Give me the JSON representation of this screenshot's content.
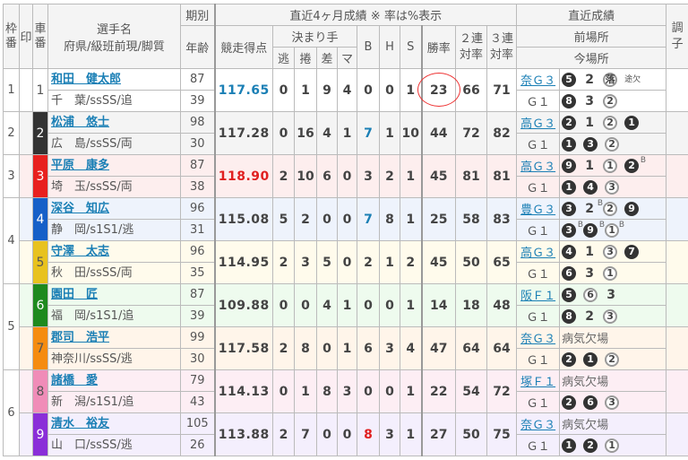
{
  "header": {
    "waku": "枠番",
    "mark": "印",
    "car": "車番",
    "name": "選手名",
    "name_sub": "府県/級班前現/脚質",
    "term": "期別",
    "age": "年齢",
    "recent4": "直近4ヶ月成績 ※ 率は%表示",
    "score": "競走得点",
    "kimarite": "決まり手",
    "nige": "逃",
    "makuri": "捲",
    "sashi": "差",
    "mark_k": "マ",
    "b": "B",
    "h": "H",
    "s": "S",
    "win": "勝率",
    "ren2": "２連対率",
    "ren3": "３連対率",
    "recent": "直近成績",
    "prev": "前場所",
    "curr": "今場所",
    "cond": "調子"
  },
  "colors": {
    "link": "#1a7fb5",
    "score_high": "#e02020",
    "b_blue": "#1a7fb5",
    "b_red": "#e02020"
  },
  "rows": [
    {
      "waku": "1",
      "car": "1",
      "car_color": "#ffffff",
      "car_text": "#555",
      "bg": "#ffffff",
      "name": "和田　健太郎",
      "info": "千　葉/ssSS/追",
      "term": "87",
      "age": "39",
      "score": "117.65",
      "score_color": "#1a7fb5",
      "k": [
        "0",
        "1",
        "9",
        "4"
      ],
      "b": "0",
      "h": "0",
      "s": "1",
      "win": "23",
      "r2": "66",
      "r3": "71",
      "prev_place": "奈Ｇ３",
      "prev": [
        {
          "n": "5",
          "t": "black"
        },
        {
          "n": "2",
          "t": "plain"
        },
        {
          "n": "落",
          "t": "white"
        },
        {
          "n": "途欠",
          "t": "word"
        }
      ],
      "curr_place": "Ｇ１",
      "curr": [
        {
          "n": "8",
          "t": "black"
        },
        {
          "n": "3",
          "t": "plain"
        },
        {
          "n": "2",
          "t": "white"
        }
      ]
    },
    {
      "waku": "2",
      "car": "2",
      "car_color": "#333333",
      "car_text": "#fff",
      "bg": "#f4f4f4",
      "name": "松浦　悠士",
      "info": "広　島/ssSS/両",
      "term": "98",
      "age": "30",
      "score": "117.28",
      "k": [
        "0",
        "16",
        "4",
        "1"
      ],
      "b": "7",
      "b_color": "#1a7fb5",
      "h": "1",
      "s": "10",
      "win": "44",
      "r2": "72",
      "r3": "82",
      "prev_place": "高Ｇ３",
      "prev": [
        {
          "n": "2",
          "t": "black"
        },
        {
          "n": "1",
          "t": "plain"
        },
        {
          "n": "2",
          "t": "white"
        },
        {
          "n": "1",
          "t": "black"
        }
      ],
      "curr_place": "Ｇ１",
      "curr": [
        {
          "n": "1",
          "t": "black"
        },
        {
          "n": "3",
          "t": "black"
        },
        {
          "n": "2",
          "t": "white"
        }
      ]
    },
    {
      "waku": "3",
      "car": "3",
      "car_color": "#e8201e",
      "car_text": "#fff",
      "bg": "#fdeeee",
      "name": "平原　康多",
      "info": "埼　玉/ssSS/両",
      "term": "87",
      "age": "38",
      "score": "118.90",
      "score_color": "#e02020",
      "k": [
        "2",
        "10",
        "6",
        "0"
      ],
      "b": "3",
      "h": "2",
      "s": "1",
      "win": "45",
      "r2": "81",
      "r3": "81",
      "prev_place": "高Ｇ３",
      "prev": [
        {
          "n": "9",
          "t": "black"
        },
        {
          "n": "1",
          "t": "plain"
        },
        {
          "n": "1",
          "t": "white"
        },
        {
          "n": "2",
          "t": "black",
          "sup": "B"
        }
      ],
      "curr_place": "Ｇ１",
      "curr": [
        {
          "n": "1",
          "t": "black"
        },
        {
          "n": "4",
          "t": "black"
        },
        {
          "n": "3",
          "t": "white"
        }
      ]
    },
    {
      "waku": "4",
      "car": "4",
      "car_color": "#1560c8",
      "car_text": "#fff",
      "bg": "#eef3fc",
      "name": "深谷　知広",
      "info": "静　岡/s1S1/逃",
      "term": "96",
      "age": "31",
      "score": "115.08",
      "k": [
        "5",
        "2",
        "0",
        "0"
      ],
      "b": "7",
      "b_color": "#1a7fb5",
      "h": "8",
      "s": "1",
      "win": "25",
      "r2": "58",
      "r3": "83",
      "prev_place": "豊Ｇ３",
      "prev": [
        {
          "n": "3",
          "t": "black"
        },
        {
          "n": "2",
          "t": "plain",
          "sup": "B"
        },
        {
          "n": "2",
          "t": "white"
        },
        {
          "n": "9",
          "t": "black"
        }
      ],
      "curr_place": "Ｇ１",
      "curr": [
        {
          "n": "3",
          "t": "black",
          "sup": "B"
        },
        {
          "n": "9",
          "t": "black",
          "sup": "B"
        },
        {
          "n": "1",
          "t": "white",
          "sup": "B"
        }
      ]
    },
    {
      "waku": "4",
      "car": "5",
      "car_color": "#e8c21e",
      "car_text": "#555",
      "bg": "#fffbec",
      "name": "守澤　太志",
      "info": "秋　田/ssSS/両",
      "term": "96",
      "age": "35",
      "score": "114.95",
      "k": [
        "2",
        "3",
        "5",
        "0"
      ],
      "b": "2",
      "h": "1",
      "s": "2",
      "win": "45",
      "r2": "50",
      "r3": "65",
      "prev_place": "高Ｇ３",
      "prev": [
        {
          "n": "4",
          "t": "black"
        },
        {
          "n": "1",
          "t": "plain"
        },
        {
          "n": "3",
          "t": "white"
        },
        {
          "n": "7",
          "t": "black"
        }
      ],
      "curr_place": "Ｇ１",
      "curr": [
        {
          "n": "6",
          "t": "black"
        },
        {
          "n": "3",
          "t": "plain"
        },
        {
          "n": "1",
          "t": "white"
        }
      ]
    },
    {
      "waku": "5",
      "car": "6",
      "car_color": "#1e8a1e",
      "car_text": "#fff",
      "bg": "#eefbee",
      "name": "園田　匠",
      "info": "福　岡/s1S1/追",
      "term": "87",
      "age": "39",
      "score": "109.88",
      "k": [
        "0",
        "0",
        "4",
        "1"
      ],
      "b": "0",
      "h": "0",
      "s": "1",
      "win": "14",
      "r2": "18",
      "r3": "48",
      "prev_place": "阪Ｆ１",
      "prev": [
        {
          "n": "5",
          "t": "black"
        },
        {
          "n": "6",
          "t": "white"
        },
        {
          "n": "3",
          "t": "plain"
        }
      ],
      "curr_place": "Ｇ１",
      "curr": [
        {
          "n": "8",
          "t": "black"
        },
        {
          "n": "2",
          "t": "plain"
        },
        {
          "n": "3",
          "t": "white"
        }
      ]
    },
    {
      "waku": "5",
      "car": "7",
      "car_color": "#f58c10",
      "car_text": "#555",
      "bg": "#fff5ea",
      "name": "郡司　浩平",
      "info": "神奈川/ssSS/逃",
      "term": "99",
      "age": "30",
      "score": "117.58",
      "k": [
        "2",
        "8",
        "0",
        "1"
      ],
      "b": "6",
      "h": "3",
      "s": "4",
      "win": "47",
      "r2": "64",
      "r3": "64",
      "prev_place": "奈Ｇ３",
      "prev_text": "病気欠場",
      "prev": [],
      "curr_place": "Ｇ１",
      "curr": [
        {
          "n": "2",
          "t": "black"
        },
        {
          "n": "1",
          "t": "black"
        },
        {
          "n": "2",
          "t": "white"
        }
      ]
    },
    {
      "waku": "6",
      "car": "8",
      "car_color": "#f08cb8",
      "car_text": "#555",
      "bg": "#fdeef4",
      "name": "諸橋　愛",
      "info": "新　潟/s1S1/追",
      "term": "79",
      "age": "43",
      "score": "114.13",
      "k": [
        "0",
        "1",
        "8",
        "3"
      ],
      "b": "0",
      "h": "0",
      "s": "1",
      "win": "22",
      "r2": "54",
      "r3": "72",
      "prev_place": "塚Ｆ１",
      "prev_text": "病気欠場",
      "prev": [],
      "curr_place": "Ｇ１",
      "curr": [
        {
          "n": "2",
          "t": "black"
        },
        {
          "n": "6",
          "t": "black"
        },
        {
          "n": "3",
          "t": "white"
        }
      ]
    },
    {
      "waku": "6",
      "car": "9",
      "car_color": "#8a2ed8",
      "car_text": "#fff",
      "bg": "#f4effd",
      "name": "清水　裕友",
      "info": "山　口/ssSS/逃",
      "term": "105",
      "age": "26",
      "score": "113.88",
      "k": [
        "2",
        "7",
        "0",
        "0"
      ],
      "b": "8",
      "b_color": "#e02020",
      "h": "3",
      "s": "1",
      "win": "27",
      "r2": "50",
      "r3": "75",
      "prev_place": "奈Ｇ３",
      "prev_text": "病気欠場",
      "prev": [],
      "curr_place": "Ｇ１",
      "curr": [
        {
          "n": "1",
          "t": "black"
        },
        {
          "n": "2",
          "t": "black"
        },
        {
          "n": "1",
          "t": "white"
        }
      ]
    }
  ]
}
